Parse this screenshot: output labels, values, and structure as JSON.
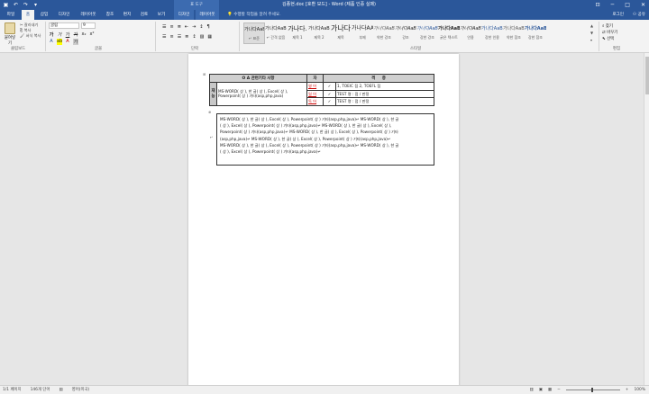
{
  "titlebar": {
    "doc_title": "김종현.doc [호환 모드] - Word (제품 인증 실패)",
    "context_tab_group": "표 도구",
    "user": "로그인",
    "controls": [
      "─",
      "□",
      "✕"
    ]
  },
  "tabs": [
    {
      "label": "파일"
    },
    {
      "label": "홈"
    },
    {
      "label": "삽입"
    },
    {
      "label": "디자인"
    },
    {
      "label": "레이아웃"
    },
    {
      "label": "참조"
    },
    {
      "label": "편지"
    },
    {
      "label": "검토"
    },
    {
      "label": "보기"
    },
    {
      "label": "디자인"
    },
    {
      "label": "레이아웃"
    }
  ],
  "tell_me": "수행할 작업을 알려 주세요.",
  "share": "공유",
  "ribbon": {
    "paste_label": "붙여넣기",
    "cut": "잘라내기",
    "copy": "복사",
    "format_painter": "서식 복사",
    "font_name": "굴림",
    "font_size": "9",
    "groups": {
      "clipboard": "클립보드",
      "font": "글꼴",
      "paragraph": "단락",
      "styles": "스타일",
      "editing": "편집"
    },
    "styles": [
      {
        "preview": "가나다AaBl",
        "name": "↵ 표준"
      },
      {
        "preview": "가나다AaBl",
        "name": "↵ 간격 없음"
      },
      {
        "preview": "가나다.",
        "name": "제목 1"
      },
      {
        "preview": "가나다AaBl",
        "name": "제목 2"
      },
      {
        "preview": "가나다",
        "name": "제목"
      },
      {
        "preview": "가나다AA",
        "name": "부제"
      },
      {
        "preview": "가나다AaB",
        "name": "약한 강조"
      },
      {
        "preview": "가나다AaB",
        "name": "강조"
      },
      {
        "preview": "가나다AaB",
        "name": "강한 강조"
      },
      {
        "preview": "가나다AaB",
        "name": "굵은 텍스트"
      },
      {
        "preview": "가나다AaB",
        "name": "인용"
      },
      {
        "preview": "가나다AaBb",
        "name": "강한 인용"
      },
      {
        "preview": "가나다AaBl",
        "name": "약한 참조"
      },
      {
        "preview": "가나다AaBl",
        "name": "강한 참조"
      }
    ],
    "find": "찾기",
    "replace": "바꾸기",
    "select": "선택"
  },
  "document": {
    "table_header": "O A 관련기타 사항",
    "header_cols": [
      "자",
      "격",
      "증"
    ],
    "side_label": "재능",
    "skills_text": "MS-WORD( 상 ), 한 글( 상 ), Excel( 상 ), Powerpoint( 상 ) 기타(asp,php,java)",
    "lang_rows": [
      {
        "lang": "영 어",
        "mark": "✓",
        "cert": "1, TOEIC 점 2, TOEFL 점"
      },
      {
        "lang": "일 어",
        "mark": "✓",
        "cert": "TEST 명 : 점 / 판정"
      },
      {
        "lang": "독 어",
        "mark": "✓",
        "cert": "TEST 명 : 점 / 판정"
      }
    ],
    "body_lines": [
      "MS-WORD( 상 ), 한 글( 상 ), Excel( 상 ), Powerpoint( 상 ) 기타(asp,php,java)↵ MS-WORD( 상 ), 한 글",
      "( 상 ), Excel( 상 ), Powerpoint( 상 ) 기타(asp,php,java)↵ MS-WORD( 상 ), 한 글( 상 ), Excel( 상 ),",
      "Powerpoint( 상 ) 기타(asp,php,java)↵ MS-WORD( 상 ), 한 글( 상 ), Excel( 상 ), Powerpoint( 상 ) 기타",
      "(asp,php,java)↵ MS-WORD( 상 ), 한 글( 상 ), Excel( 상 ), Powerpoint( 상 ) 기타(asp,php,java)↵",
      "MS-WORD( 상 ), 한 글( 상 ), Excel( 상 ), Powerpoint( 상 ) 기타(asp,php,java)↵ MS-WORD( 상 ), 한 글",
      "( 상 ), Excel( 상 ), Powerpoint( 상 ) 기타(asp,php,java)↵"
    ]
  },
  "statusbar": {
    "page": "1/1 페이지",
    "words": "146개 단어",
    "language": "영어(미국)",
    "zoom": "100%"
  }
}
